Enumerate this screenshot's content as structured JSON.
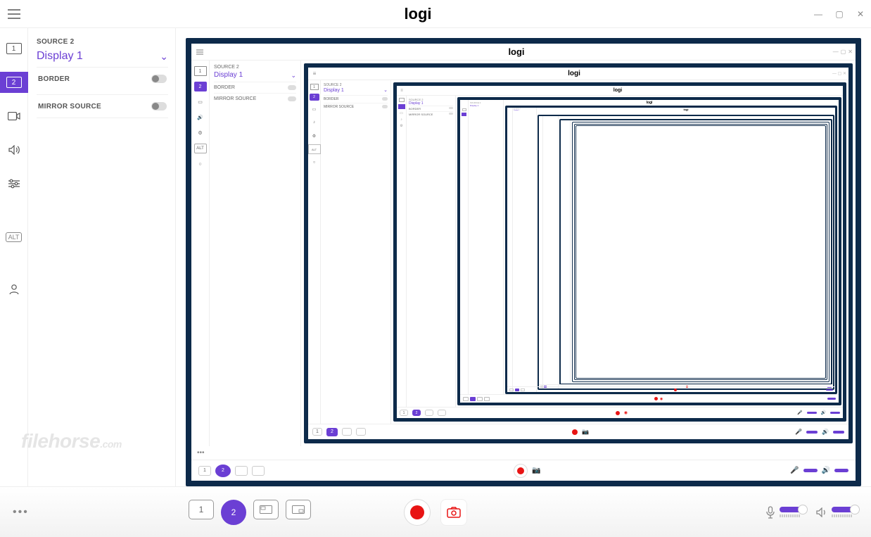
{
  "brand_logo": "logi",
  "window_controls": {
    "min": "—",
    "max": "▢",
    "close": "✕"
  },
  "sidebar": {
    "source_label": "SOURCE 2",
    "source_title": "Display 1",
    "rows": {
      "border": {
        "label": "BORDER",
        "state": "off"
      },
      "mirror": {
        "label": "MIRROR SOURCE",
        "state": "off"
      }
    }
  },
  "left_rail": {
    "items": [
      {
        "id": "scene-1",
        "label": "1"
      },
      {
        "id": "scene-2",
        "label": "2",
        "active": true
      }
    ],
    "alt_label": "ALT"
  },
  "bottom": {
    "scenes": [
      {
        "id": "s1",
        "label": "1"
      },
      {
        "id": "s2",
        "label": "2",
        "active": true
      },
      {
        "id": "s3",
        "label": ""
      },
      {
        "id": "s4",
        "label": ""
      }
    ]
  },
  "watermark": "filehorse",
  "watermark_suffix": ".com",
  "colors": {
    "accent": "#6b3fd4",
    "record": "#e81414",
    "frame_border": "#0d2a4a"
  }
}
